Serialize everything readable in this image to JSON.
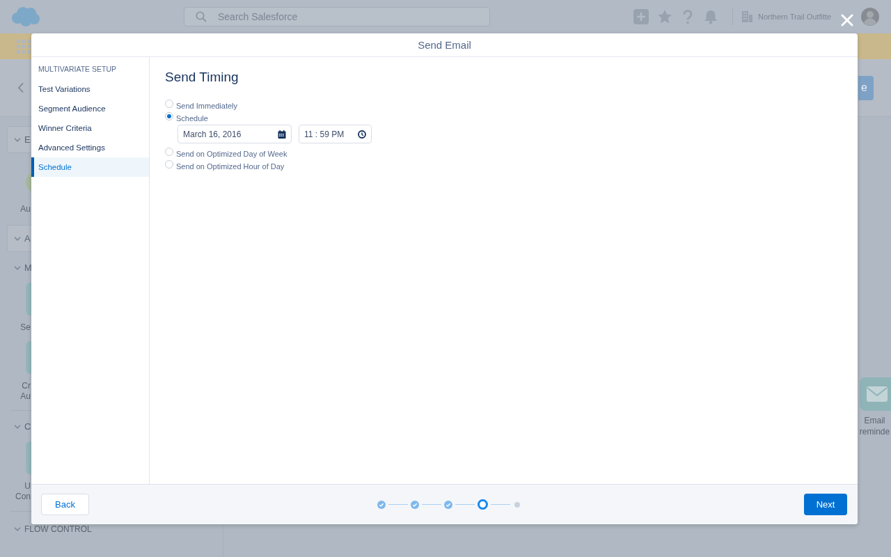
{
  "background": {
    "header": {
      "search": {
        "placeholder": "Search Salesforce"
      },
      "org_name": "Northern Trail Outfitte"
    },
    "page_header": {
      "button": {
        "label": "e"
      }
    },
    "left_panel": {
      "sections": [
        {
          "kind": "card",
          "label": "E",
          "items": [
            {
              "kind": "circle",
              "label_lines": [
                "Au"
              ]
            }
          ]
        },
        {
          "kind": "card",
          "label": "A"
        },
        {
          "kind": "header",
          "label": "M",
          "items": [
            {
              "kind": "tile",
              "label_lines": [
                "Se"
              ]
            },
            {
              "kind": "tile",
              "label_lines": [
                "Cr",
                "Au"
              ]
            }
          ]
        },
        {
          "kind": "header",
          "label": "C",
          "items": [
            {
              "kind": "tile",
              "label_lines": [
                "U",
                "Con"
              ]
            }
          ]
        },
        {
          "kind": "header",
          "label": "FLOW CONTROL"
        }
      ]
    },
    "email_tile": {
      "label_lines": [
        "Email",
        "reminde"
      ]
    }
  },
  "modal": {
    "title": "Send Email",
    "sidebar": {
      "heading": "MULTIVARIATE SETUP",
      "items": [
        {
          "label": "Test Variations",
          "selected": false
        },
        {
          "label": "Segment Audience",
          "selected": false
        },
        {
          "label": "Winner Criteria",
          "selected": false
        },
        {
          "label": "Advanced Settings",
          "selected": false
        },
        {
          "label": "Schedule",
          "selected": true
        }
      ]
    },
    "content": {
      "title": "Send Timing",
      "options": [
        {
          "label": "Send Immediately",
          "selected": false
        },
        {
          "label": "Schedule",
          "selected": true,
          "date_field": {
            "value": "March 16, 2016"
          },
          "time_field": {
            "value": "11 : 59 PM"
          }
        },
        {
          "label": "Send on Optimized Day of Week",
          "selected": false
        },
        {
          "label": "Send on Optimized Hour of Day",
          "selected": false
        }
      ]
    },
    "footer": {
      "back_button": "Back",
      "progress": {
        "steps": [
          {
            "completed": true,
            "current": false
          },
          {
            "completed": true,
            "current": false
          },
          {
            "completed": true,
            "current": false
          },
          {
            "completed": false,
            "current": true
          },
          {
            "completed": false,
            "current": false
          }
        ]
      },
      "next_button": "Next"
    }
  }
}
